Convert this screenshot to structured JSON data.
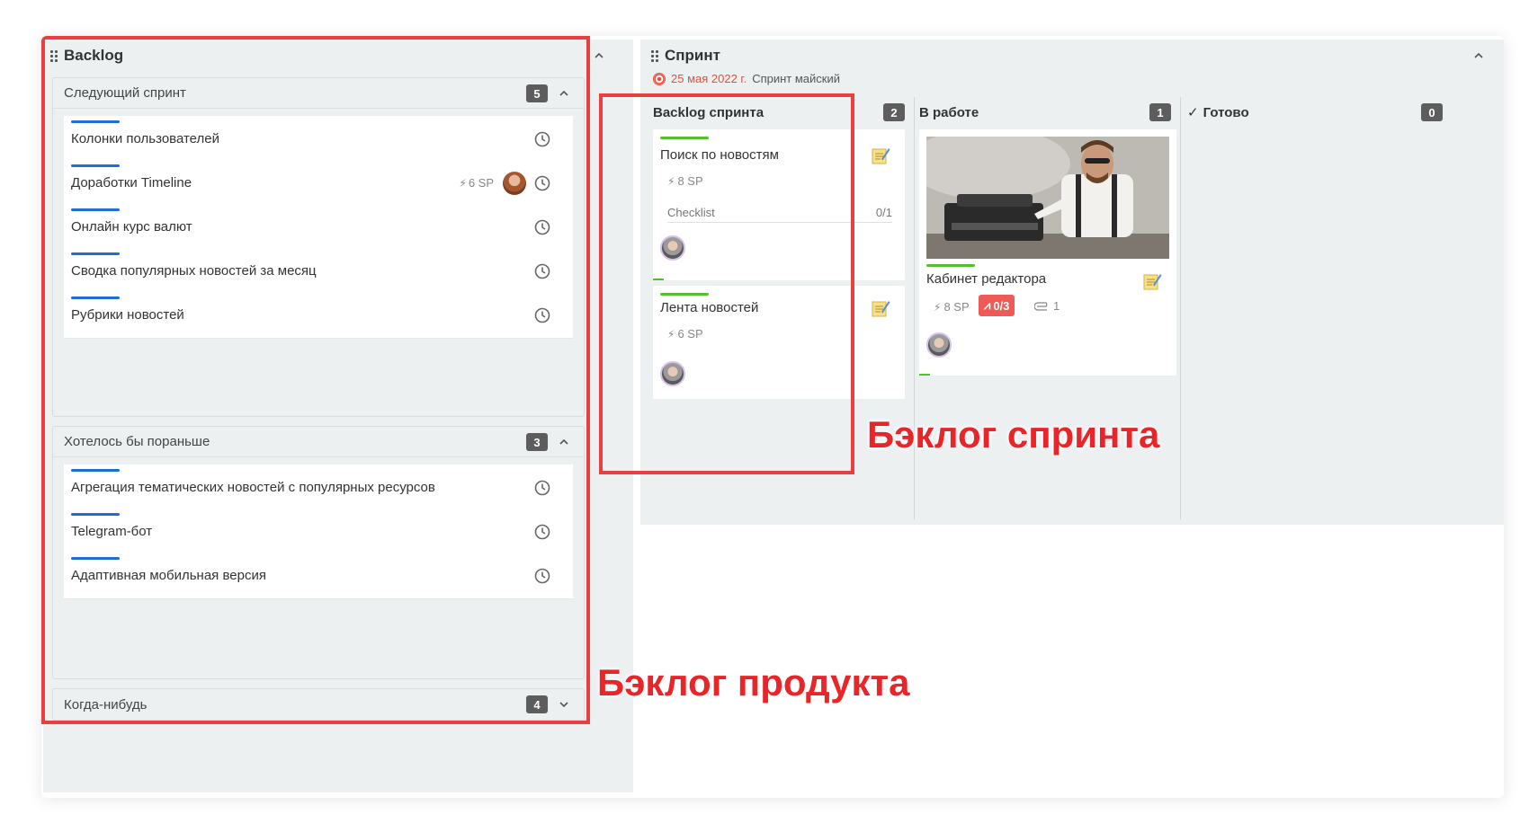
{
  "backlog": {
    "title": "Backlog",
    "groups": [
      {
        "title": "Следующий спринт",
        "count": "5",
        "tasks": [
          {
            "title": "Колонки пользователей"
          },
          {
            "title": "Доработки Timeline",
            "sp": "6 SP"
          },
          {
            "title": "Онлайн курс валют"
          },
          {
            "title": "Сводка популярных новостей за месяц"
          },
          {
            "title": "Рубрики новостей"
          }
        ]
      },
      {
        "title": "Хотелось бы пораньше",
        "count": "3",
        "tasks": [
          {
            "title": "Агрегация тематических новостей с популярных ресурсов"
          },
          {
            "title": "Telegram-бот"
          },
          {
            "title": "Адаптивная мобильная версия"
          }
        ]
      },
      {
        "title": "Когда-нибудь",
        "count": "4"
      }
    ]
  },
  "sprint": {
    "title": "Спринт",
    "date": "25 мая 2022 г.",
    "name": "Спринт майский",
    "columns": [
      {
        "title": "Backlog спринта",
        "count": "2",
        "cards": [
          {
            "title": "Поиск по новостям",
            "sp": "8 SP",
            "checklist_label": "Checklist",
            "checklist_value": "0/1"
          },
          {
            "title": "Лента новостей",
            "sp": "6 SP"
          }
        ]
      },
      {
        "title": "В работе",
        "count": "1",
        "cards": [
          {
            "title": "Кабинет редактора",
            "sp": "8 SP",
            "subtasks": "0/3",
            "attachments": "1"
          }
        ]
      },
      {
        "title": "Готово",
        "count": "0"
      }
    ]
  },
  "annotations": {
    "sprint_backlog": "Бэклог спринта",
    "product_backlog": "Бэклог продукта"
  },
  "colors": {
    "accent_blue": "#1e6fd0",
    "accent_green": "#55c02e",
    "accent_red": "#e84040",
    "panel_bg": "#ecf0f1"
  }
}
